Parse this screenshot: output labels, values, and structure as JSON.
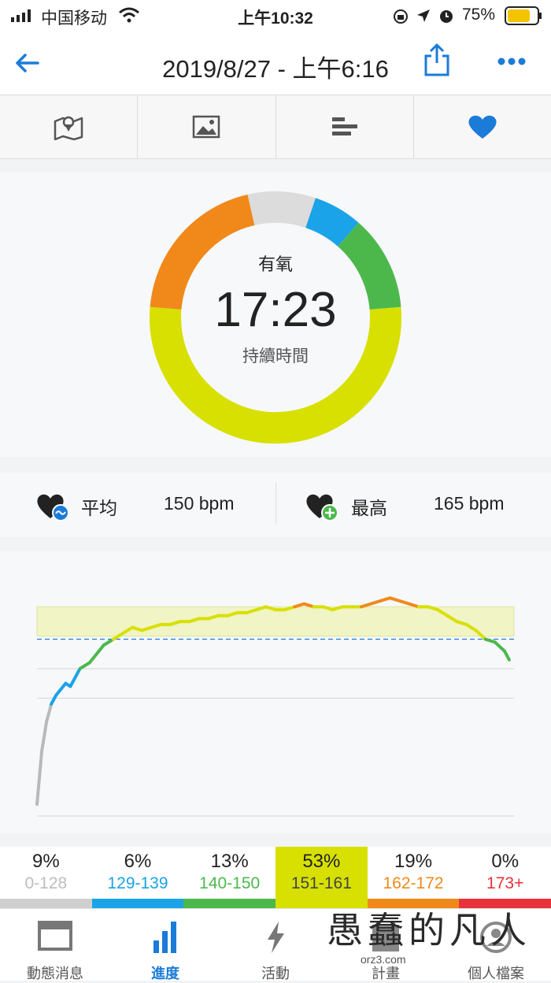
{
  "status_bar": {
    "carrier": "中国移动",
    "time": "上午10:32",
    "battery": "75%",
    "battery_level": 0.75
  },
  "header": {
    "title": "2019/8/27 - 上午6:16",
    "back_icon": "arrow-left-icon",
    "share_icon": "share-icon",
    "more_icon": "more-icon"
  },
  "tabs": [
    {
      "icon": "map-icon"
    },
    {
      "icon": "image-icon"
    },
    {
      "icon": "bar-list-icon"
    },
    {
      "icon": "heart-icon",
      "active": true
    }
  ],
  "donut": {
    "label": "有氧",
    "value": "17:23",
    "caption": "持續時間",
    "colors": {
      "gray": "#dcdcdc",
      "blue": "#1aa3e8",
      "green": "#4cb84c",
      "yellow": "#d7e000",
      "orange": "#f0891a"
    }
  },
  "stats": {
    "avg_label": "平均",
    "avg_value": "150 bpm",
    "max_label": "最高",
    "max_value": "165 bpm"
  },
  "chart_data": {
    "type": "line",
    "title": "",
    "xlabel": "",
    "ylabel": "",
    "x_range": [
      0,
      100
    ],
    "y_range": [
      90,
      175
    ],
    "highlight_band": [
      151,
      161
    ],
    "average_line": 150,
    "points": [
      [
        0,
        94
      ],
      [
        1,
        112
      ],
      [
        2,
        122
      ],
      [
        3,
        128
      ],
      [
        4,
        131
      ],
      [
        5,
        133
      ],
      [
        6,
        135
      ],
      [
        7,
        134
      ],
      [
        8,
        137
      ],
      [
        9,
        140
      ],
      [
        10,
        141
      ],
      [
        11,
        142
      ],
      [
        12,
        144
      ],
      [
        13,
        146
      ],
      [
        14,
        148
      ],
      [
        15,
        149
      ],
      [
        16,
        150
      ],
      [
        17,
        151
      ],
      [
        18,
        152
      ],
      [
        19,
        153
      ],
      [
        20,
        154
      ],
      [
        22,
        153
      ],
      [
        24,
        154
      ],
      [
        26,
        155
      ],
      [
        28,
        155
      ],
      [
        30,
        156
      ],
      [
        32,
        156
      ],
      [
        34,
        157
      ],
      [
        36,
        157
      ],
      [
        38,
        158
      ],
      [
        40,
        158
      ],
      [
        42,
        159
      ],
      [
        44,
        159
      ],
      [
        46,
        160
      ],
      [
        48,
        161
      ],
      [
        50,
        160
      ],
      [
        52,
        160
      ],
      [
        54,
        161
      ],
      [
        56,
        162
      ],
      [
        58,
        161
      ],
      [
        60,
        161
      ],
      [
        62,
        160
      ],
      [
        64,
        161
      ],
      [
        66,
        161
      ],
      [
        68,
        161
      ],
      [
        70,
        162
      ],
      [
        72,
        163
      ],
      [
        74,
        164
      ],
      [
        76,
        163
      ],
      [
        78,
        162
      ],
      [
        80,
        161
      ],
      [
        82,
        161
      ],
      [
        84,
        160
      ],
      [
        86,
        158
      ],
      [
        88,
        156
      ],
      [
        90,
        155
      ],
      [
        92,
        153
      ],
      [
        94,
        150
      ],
      [
        96,
        149
      ],
      [
        98,
        146
      ],
      [
        99,
        143
      ]
    ]
  },
  "zones": [
    {
      "pct": "9%",
      "range": "0-128",
      "color": "#cfcfcf",
      "text_color": "#bdbdbd"
    },
    {
      "pct": "6%",
      "range": "129-139",
      "color": "#1aa3e8",
      "text_color": "#1aa3e8"
    },
    {
      "pct": "13%",
      "range": "140-150",
      "color": "#4cb84c",
      "text_color": "#4cb84c"
    },
    {
      "pct": "53%",
      "range": "151-161",
      "color": "#d7e000",
      "text_color": "#444444",
      "active": true
    },
    {
      "pct": "19%",
      "range": "162-172",
      "color": "#f0891a",
      "text_color": "#f0891a"
    },
    {
      "pct": "0%",
      "range": "173+",
      "color": "#e8333a",
      "text_color": "#e8333a"
    }
  ],
  "bottom_nav": [
    {
      "label": "動態消息",
      "icon": "news-icon"
    },
    {
      "label": "進度",
      "icon": "bar-chart-icon",
      "active": true
    },
    {
      "label": "活動",
      "icon": "lightning-icon"
    },
    {
      "label": "計畫",
      "icon": "calendar-icon"
    },
    {
      "label": "個人檔案",
      "icon": "profile-icon"
    }
  ],
  "watermark": {
    "text": "愚蠢的凡人",
    "site": "orz3.com"
  }
}
